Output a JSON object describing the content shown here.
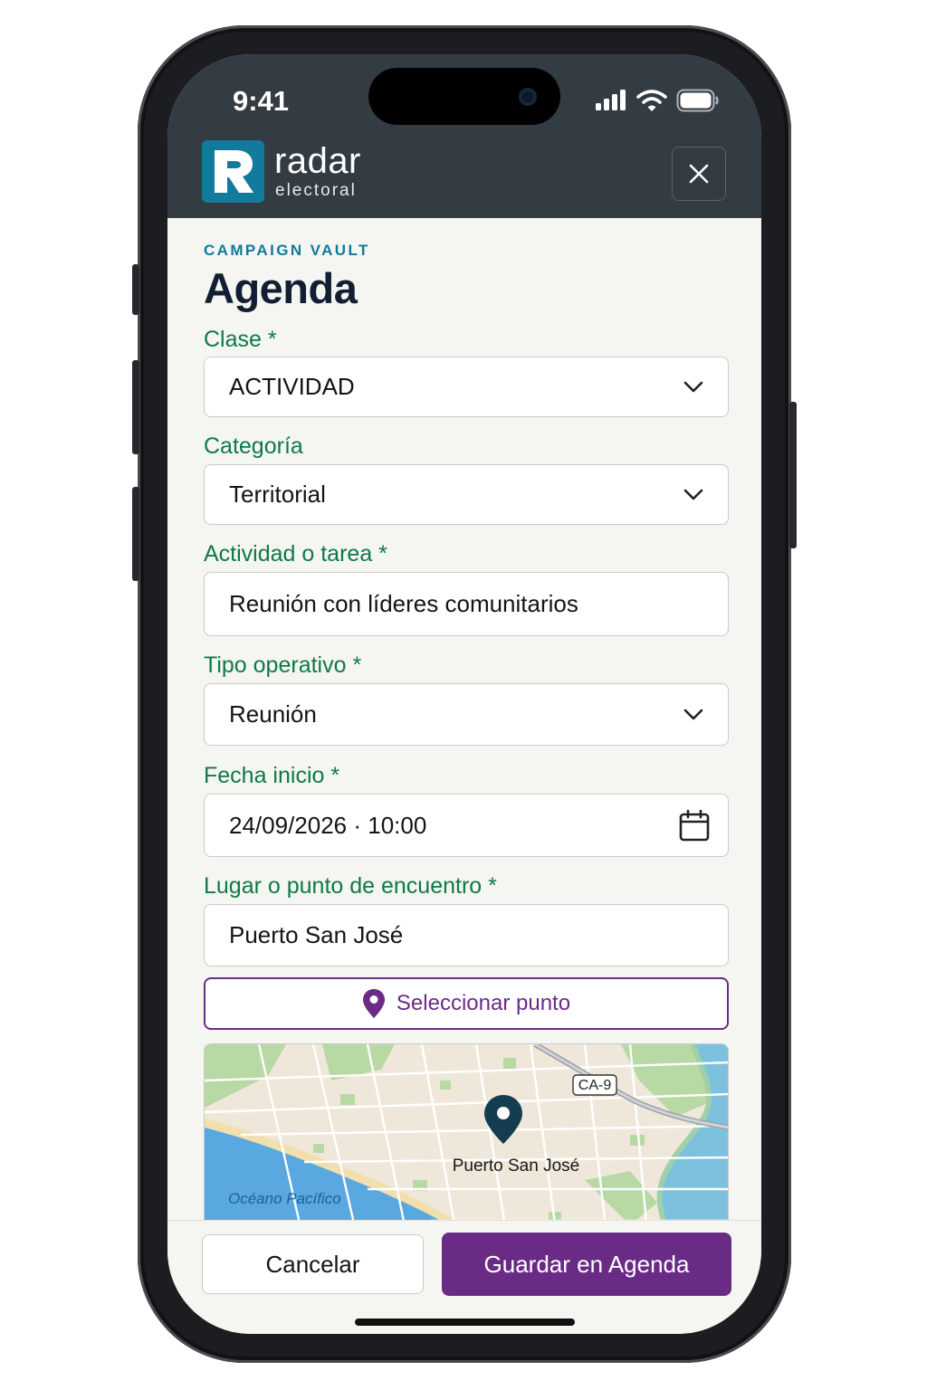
{
  "status_bar": {
    "time": "9:41"
  },
  "brand": {
    "name": "radar",
    "subtitle": "electoral",
    "color": "#127a9c"
  },
  "header": {
    "close_icon": "close-icon"
  },
  "page": {
    "eyebrow": "CAMPAIGN VAULT",
    "title": "Agenda"
  },
  "form": {
    "clase": {
      "label": "Clase *",
      "value": "ACTIVIDAD"
    },
    "categoria": {
      "label": "Categoría",
      "value": "Territorial"
    },
    "actividad": {
      "label": "Actividad o tarea *",
      "value": "Reunión con líderes comunitarios"
    },
    "tipo": {
      "label": "Tipo operativo *",
      "value": "Reunión"
    },
    "fecha": {
      "label": "Fecha inicio *",
      "value": "24/09/2026 · 10:00"
    },
    "lugar": {
      "label": "Lugar o punto de encuentro *",
      "value": "Puerto San José"
    },
    "select_point_label": "Seleccionar punto"
  },
  "map": {
    "road_label": "CA-9",
    "place_label": "Puerto San José",
    "ocean_label": "Océano Pacífico"
  },
  "footer": {
    "cancel_label": "Cancelar",
    "save_label": "Guardar en Agenda"
  },
  "colors": {
    "label_green": "#0e7a46",
    "accent_purple": "#6a2b86",
    "header_bg": "#333b43"
  }
}
